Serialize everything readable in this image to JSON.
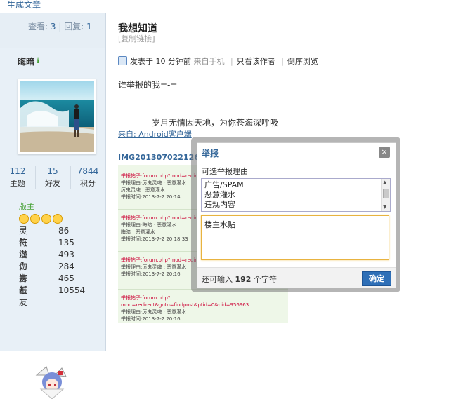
{
  "topbar": {
    "link": "生成文章"
  },
  "stats": {
    "view_label": "查看:",
    "views": "3",
    "sep": "|",
    "reply_label": "回复:",
    "replies": "1"
  },
  "user": {
    "name": "晦暗",
    "counts": [
      {
        "value": "112",
        "label": "主题"
      },
      {
        "value": "15",
        "label": "好友"
      },
      {
        "value": "7844",
        "label": "积分"
      }
    ],
    "rank": "版主",
    "attributes": [
      {
        "key": "灵符",
        "value": "86"
      },
      {
        "key": "气血",
        "value": "135"
      },
      {
        "key": "潜力",
        "value": "493"
      },
      {
        "key": "伤害",
        "value": "284"
      },
      {
        "key": "妹纸",
        "value": "465"
      },
      {
        "key": "基友",
        "value": "10554"
      }
    ]
  },
  "post": {
    "title": "我想知道",
    "copy_link": "[复制链接]",
    "meta": {
      "posted": "发表于 10 分钟前",
      "source": "来自手机",
      "only_author": "只看该作者",
      "reverse": "倒序浏览"
    },
    "line1": "谁举报的我=-=",
    "line2": "————岁月无情因天地，为你苍海深呼吸",
    "from": "来自: Android客户端",
    "image_link": "IMG2013070221260",
    "screenshot_blocks": [
      {
        "l1": "举报帖子:forum.php?mod=redirec",
        "l2": "举报理由:厉鬼灵魂 : 恶意灌水",
        "l3": "厉鬼灵魂 : 恶意灌水",
        "l4": "举报时间:2013-7-2 20:14"
      },
      {
        "l1": "举报帖子:forum.php?mod=redirec",
        "l2": "举报理由:晦暗 : 恶意灌水",
        "l3": "晦暗 : 恶意灌水",
        "l4": "举报时间:2013-7-2 20 18:33"
      },
      {
        "l1": "举报帖子:forum.php?mod=redirec",
        "l2": "举报理由:厉鬼灵魂 : 恶意灌水",
        "l3": "",
        "l4": "举报时间:2013-7-2 20:16"
      },
      {
        "l1": "举报帖子:forum.php?mod=redirect&goto=findpost&ptid=0&pid=956963",
        "l2": "举报理由:厉鬼灵魂 : 恶意灌水",
        "l3": "",
        "l4": "举报时间:2013-7-2 20:16"
      }
    ]
  },
  "dialog": {
    "title": "举报",
    "close": "×",
    "reason_label": "可选举报理由",
    "options": [
      "广告/SPAM",
      "恶意灌水",
      "违规内容"
    ],
    "text_value": "楼主水贴",
    "remain_prefix": "还可输入",
    "remain_count": "192",
    "remain_suffix": "个字符",
    "confirm": "确定"
  }
}
